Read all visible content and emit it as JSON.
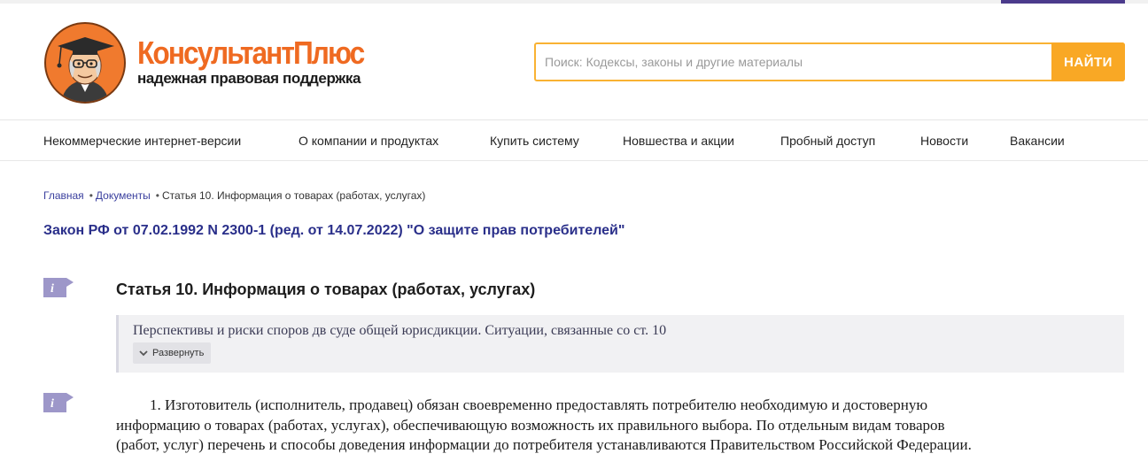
{
  "brand": {
    "name": "КонсультантПлюс",
    "tagline": "надежная правовая поддержка"
  },
  "search": {
    "placeholder": "Поиск: Кодексы, законы и другие материалы",
    "button_label": "НАЙТИ"
  },
  "nav": {
    "items": [
      {
        "label": "Некоммерческие интернет-версии"
      },
      {
        "label": "О компании и продуктах"
      },
      {
        "label": "Купить систему"
      },
      {
        "label": "Новшества и акции"
      },
      {
        "label": "Пробный доступ"
      },
      {
        "label": "Новости"
      },
      {
        "label": "Вакансии"
      }
    ]
  },
  "breadcrumb": {
    "items": [
      {
        "label": "Главная"
      },
      {
        "label": "Документы"
      },
      {
        "label": "Статья 10. Информация о товарах (работах, услугах)"
      }
    ]
  },
  "document": {
    "title": "Закон РФ от 07.02.1992 N 2300-1 (ред. от 14.07.2022) \"О защите прав потребителей\"",
    "article_heading": "Статья 10. Информация о товарах (работах, услугах)",
    "note": {
      "text": "Перспективы и риски споров дв суде общей юрисдикции. Ситуации, связанные со ст. 10",
      "expand_label": "Развернуть"
    },
    "paragraph_lines": [
      "1. Изготовитель (исполнитель, продавец) обязан своевременно предоставлять потребителю необходимую и достоверную",
      "информацию о товарах (работах, услугах), обеспечивающую возможность их правильного выбора. По отдельным видам товаров",
      "(работ, услуг) перечень и способы доведения информации до потребителя устанавливаются Правительством Российской Федерации."
    ]
  },
  "icons": {
    "info": "info-icon",
    "expand": "chevron-down-icon",
    "logo": "professor-avatar-logo"
  },
  "colors": {
    "brand_orange": "#ef6a21",
    "search_border": "#f9b233",
    "search_button": "#f9a825",
    "doc_title": "#2a2f8a",
    "link": "#3a3f9e",
    "info_icon": "#9d97c9",
    "note_bg": "#f1f1f3"
  }
}
